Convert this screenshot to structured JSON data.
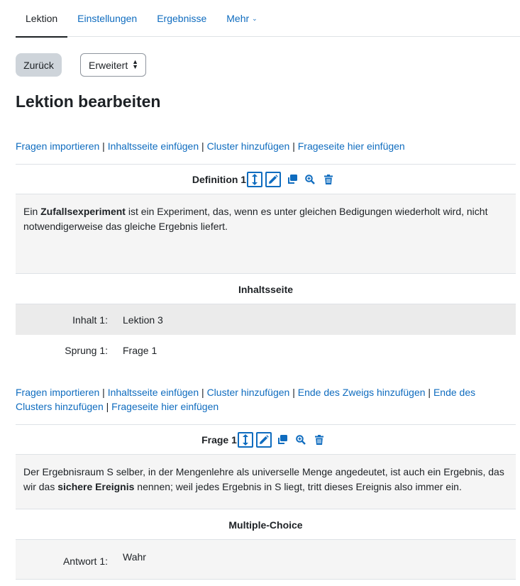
{
  "tabs": [
    {
      "label": "Lektion"
    },
    {
      "label": "Einstellungen"
    },
    {
      "label": "Ergebnisse"
    },
    {
      "label": "Mehr"
    }
  ],
  "toolbar": {
    "back_label": "Zurück",
    "view_select": "Erweitert"
  },
  "title": "Lektion bearbeiten",
  "add_links_1": [
    "Fragen importieren",
    "Inhaltsseite einfügen",
    "Cluster hinzufügen",
    "Frageseite hier einfügen"
  ],
  "add_links_2": [
    "Fragen importieren",
    "Inhaltsseite einfügen",
    "Cluster hinzufügen",
    "Ende des Zweigs hinzufügen",
    "Ende des Clusters hinzufügen",
    "Frageseite hier einfügen"
  ],
  "separator": "|",
  "pages": [
    {
      "title": "Definition 1",
      "content_pre": "Ein ",
      "content_bold": "Zufallsexperiment",
      "content_post": " ist ein Experiment, das, wenn es unter gleichen Bedigungen wiederholt wird, nicht notwendigerweise das gleiche Ergebnis liefert.",
      "type": "Inhaltsseite",
      "rows": [
        {
          "key": "Inhalt 1:",
          "value": "Lektion 3"
        },
        {
          "key": "Sprung 1:",
          "value": "Frage 1"
        }
      ]
    },
    {
      "title": "Frage 1",
      "content_pre": "Der Ergebnisraum S selber, in der Mengenlehre als universelle Menge angedeutet, ist auch ein Ergebnis, das wir das ",
      "content_bold": "sichere Ereignis",
      "content_post": " nennen; weil jedes Ergebnis in S liegt, tritt dieses Ereignis also immer ein.",
      "type": "Multiple-Choice",
      "rows": [
        {
          "key": "Antwort 1:",
          "value": "Wahr"
        }
      ]
    }
  ],
  "icons": [
    "move-icon",
    "edit-icon",
    "duplicate-icon",
    "preview-icon",
    "delete-icon"
  ],
  "colors": {
    "link": "#0f6cbf",
    "text": "#1d2125",
    "shade": "#f5f5f5",
    "button": "#ced4da"
  }
}
